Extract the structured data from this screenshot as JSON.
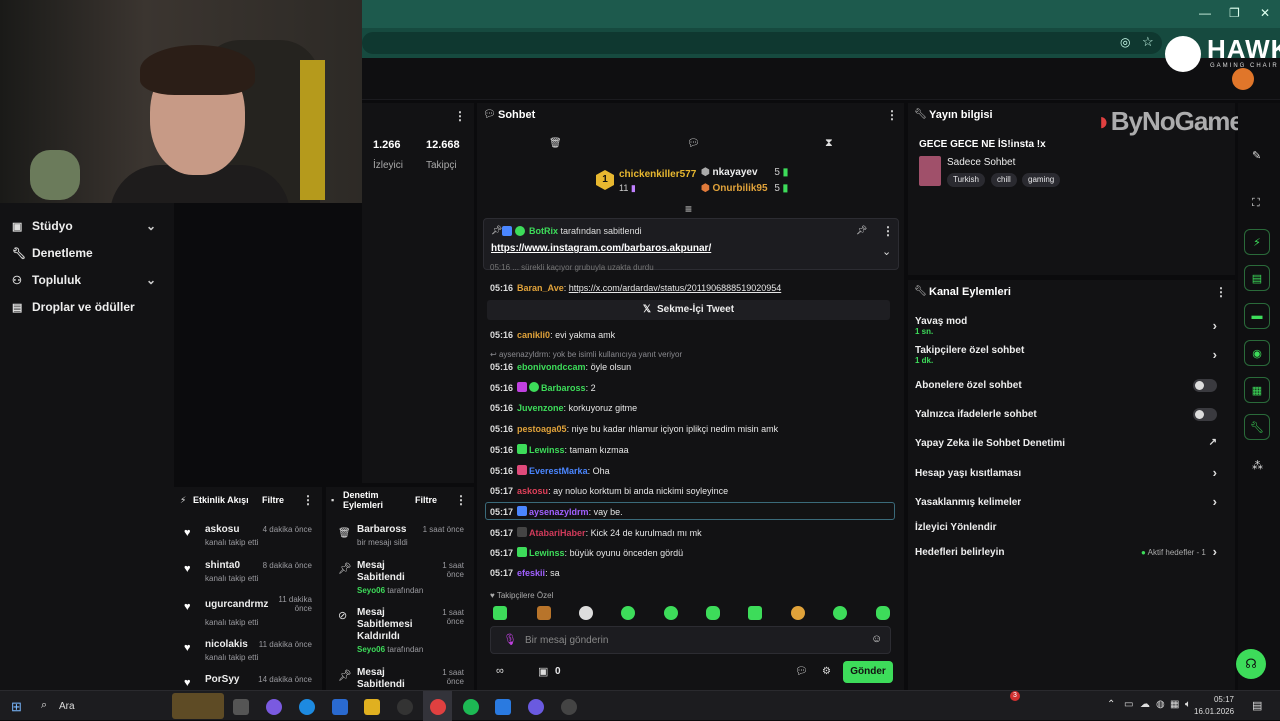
{
  "webcam": {
    "brand": "HAWK",
    "brand_sub": "GAMING CHAIR",
    "sponsor": "ByNoGame"
  },
  "sidebar": {
    "items": [
      {
        "label": "Stüdyo",
        "icon": "studio-icon",
        "chevron": true
      },
      {
        "label": "Denetleme",
        "icon": "wrench-icon",
        "chevron": false
      },
      {
        "label": "Topluluk",
        "icon": "people-icon",
        "chevron": true
      },
      {
        "label": "Droplar ve ödüller",
        "icon": "drops-icon",
        "chevron": false
      }
    ]
  },
  "stats": {
    "viewers_value": "1.266",
    "viewers_label": "İzleyici",
    "followers_value": "12.668",
    "followers_label": "Takipçi",
    "menu": "⋮"
  },
  "activity": {
    "title": "Etkinlik Akışı",
    "filter": "Filtre",
    "menu": "⋮",
    "items": [
      {
        "name": "askosu",
        "sub": "kanalı takip etti",
        "time": "4 dakika önce"
      },
      {
        "name": "shinta0",
        "sub": "kanalı takip etti",
        "time": "8 dakika önce"
      },
      {
        "name": "ugurcandrmz",
        "sub": "kanalı takip etti",
        "time": "11 dakika önce"
      },
      {
        "name": "nicolakis",
        "sub": "kanalı takip etti",
        "time": "11 dakika önce"
      },
      {
        "name": "PorSyy",
        "sub": "",
        "time": "14 dakika önce"
      }
    ]
  },
  "mod_actions": {
    "title": "Denetim Eylemleri",
    "filter": "Filtre",
    "menu": "⋮",
    "items": [
      {
        "name": "Barbaross",
        "sub": "bir mesajı sildi",
        "by": "",
        "by_suffix": "",
        "time": "1 saat önce",
        "icon": "trash-icon"
      },
      {
        "name": "Mesaj Sabitlendi",
        "sub": "",
        "by": "Seyo06",
        "by_suffix": "tarafından",
        "time": "1 saat önce",
        "icon": "pin-icon"
      },
      {
        "name": "Mesaj Sabitlemesi Kaldırıldı",
        "sub": "",
        "by": "Seyo06",
        "by_suffix": "tarafından",
        "time": "1 saat önce",
        "icon": "unpin-icon"
      },
      {
        "name": "Mesaj Sabitlendi",
        "sub": "",
        "by": "",
        "by_suffix": "",
        "time": "1 saat önce",
        "icon": "pin-icon"
      }
    ]
  },
  "chat": {
    "title": "Sohbet",
    "menu": "⋮",
    "top_gifters": [
      {
        "name": "chickenkiller577",
        "count": "11",
        "rank": "1"
      },
      {
        "name": "nkayayev",
        "count": "5",
        "rank": ""
      },
      {
        "name": "Onurbilik95",
        "count": "5",
        "rank": ""
      }
    ],
    "pinned": {
      "by": "BotRix",
      "by_suffix": "tarafından sabitlendi",
      "link": "https://www.instagram.com/barbaros.akpunar/"
    },
    "partial_line": "05:16 ... sürekli kaçıyor grubuyla uzakta durdu",
    "tweet_msg": {
      "time": "05:16",
      "user": "Baran_Ave",
      "text": "https://x.com/ardardav/status/2011906888519020954"
    },
    "tweet_button": "Sekme-İçi Tweet",
    "reply_note": "aysenazyldrm: yok be isimli kullanıcıya yanıt veriyor",
    "messages": [
      {
        "time": "05:16",
        "user": "canikli0",
        "color": "#e0a23a",
        "text": "evi yakma amk",
        "badges": []
      },
      {
        "time": "05:16",
        "user": "ebonivondccam",
        "color": "#3ddc5a",
        "text": "öyle olsun",
        "badges": []
      },
      {
        "time": "05:16",
        "user": "Barbaross",
        "color": "#3ddc5a",
        "text": "2",
        "badges": [
          "#c040e0",
          "#3ddc5a"
        ]
      },
      {
        "time": "05:16",
        "user": "Juvenzone",
        "color": "#3ddc5a",
        "text": "korkuyoruz gitme",
        "badges": []
      },
      {
        "time": "05:16",
        "user": "pestoaga05",
        "color": "#e0a23a",
        "text": "niye bu kadar ıhlamur içiyon iplikçi nedim misin amk",
        "badges": []
      },
      {
        "time": "05:16",
        "user": "Lewinss",
        "color": "#3ddc5a",
        "text": "tamam kızmaa",
        "badges": [
          "#3ddc5a"
        ]
      },
      {
        "time": "05:16",
        "user": "EverestMarka",
        "color": "#4a86ff",
        "text": "Oha",
        "badges": [
          "#e04a7a"
        ]
      },
      {
        "time": "05:17",
        "user": "askosu",
        "color": "#e0405a",
        "text": "ay noluo korktum bi anda nickimi soyleyince",
        "badges": []
      },
      {
        "time": "05:17",
        "user": "aysenazyldrm",
        "color": "#a060ff",
        "text": "vay be.",
        "badges": [
          "#4a86ff"
        ],
        "highlight": true
      },
      {
        "time": "05:17",
        "user": "AtabariHaber",
        "color": "#d03a5a",
        "text": "Kick 24 de kurulmadı mı mk",
        "badges": [
          "#444"
        ]
      },
      {
        "time": "05:17",
        "user": "Lewinss",
        "color": "#3ddc5a",
        "text": "büyük oyunu önceden gördü",
        "badges": [
          "#3ddc5a"
        ]
      },
      {
        "time": "05:17",
        "user": "efeskii",
        "color": "#a060ff",
        "text": "sa",
        "badges": []
      }
    ],
    "followers_only": "Takipçilere Özel",
    "input_placeholder": "Bir mesaj gönderin",
    "count": "0",
    "send": "Gönder"
  },
  "stream_info": {
    "title": "Yayın bilgisi",
    "stream_title": "GECE GECE NE İS!insta !x",
    "category": "Sadece Sohbet",
    "tags": [
      "Turkish",
      "chill",
      "gaming"
    ]
  },
  "channel_actions": {
    "title": "Kanal Eylemleri",
    "menu": "⋮",
    "rows": [
      {
        "label": "Yavaş mod",
        "sub": "1 sn.",
        "control": "chevron"
      },
      {
        "label": "Takipçilere özel sohbet",
        "sub": "1 dk.",
        "control": "chevron"
      },
      {
        "label": "Abonelere özel sohbet",
        "sub": "",
        "control": "toggle"
      },
      {
        "label": "Yalnızca ifadelerle sohbet",
        "sub": "",
        "control": "toggle"
      },
      {
        "label": "Yapay Zeka ile Sohbet Denetimi",
        "sub": "",
        "control": "external"
      },
      {
        "label": "Hesap yaşı kısıtlaması",
        "sub": "",
        "control": "chevron"
      },
      {
        "label": "Yasaklanmış kelimeler",
        "sub": "",
        "control": "chevron"
      },
      {
        "label": "İzleyici Yönlendir",
        "sub": "",
        "control": "none"
      },
      {
        "label": "Hedefleri belirleyin",
        "sub": "",
        "control": "chevron"
      }
    ],
    "goals_status": "Aktif hedefler - 1"
  },
  "taskbar": {
    "search": "Ara",
    "time": "05:17",
    "date": "16.01.2026",
    "notif_count": "3"
  },
  "colors": {
    "accent": "#3ddc5a",
    "panel": "#121214",
    "bg": "#0b0b0d"
  }
}
